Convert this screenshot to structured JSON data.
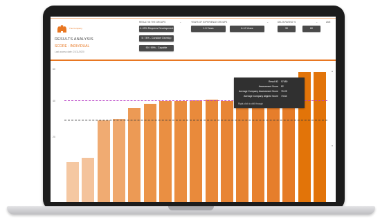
{
  "header": {
    "logo_text": "The Company",
    "title": "RESULTS ANALYSIS",
    "subtitle": "SCORE - INDIVIDUAL",
    "last_update": "Last access date: 21/11/2020"
  },
  "filters": {
    "result_group": {
      "label": "RESULT IN THE GROUPS",
      "options": [
        "4: 49% Requires Development",
        "5: 74% - Consider Develop",
        "90 / 99% - Capable"
      ]
    },
    "experience": {
      "label": "YEARS OF EXPERIENCE GROUPS",
      "options": [
        "1-5 Years",
        "6-10 Years"
      ]
    },
    "delta": {
      "label": "DELTA RATING %",
      "options": [
        "30",
        "60"
      ]
    },
    "extra_label": "ANE"
  },
  "chart_data": {
    "type": "bar",
    "y_ticks": [
      "60",
      "40",
      "20"
    ],
    "values": [
      30,
      33,
      61,
      62,
      70,
      73,
      75,
      75.5,
      76,
      76.5,
      75.5,
      74,
      76.5,
      76.5,
      77,
      97,
      97
    ],
    "reference_lines": [
      "individual average",
      "company average"
    ],
    "colors": [
      "#f5c8a2",
      "#f4c39c",
      "#f0ab72",
      "#efa86d",
      "#ec9a55",
      "#eb9448",
      "#ea8f42",
      "#ea8d3f",
      "#e98a3b",
      "#e98838",
      "#e88535",
      "#e78331",
      "#e7812e",
      "#e67e2b",
      "#e57b27",
      "#e27409",
      "#e27409"
    ]
  },
  "tooltip": {
    "rows": [
      {
        "key": "Result ID",
        "value": "97480"
      },
      {
        "key": "Assessment Score",
        "value": "82"
      },
      {
        "key": "Average Company Assessment Score",
        "value": "76.28"
      },
      {
        "key": "Average Company Aligned Score",
        "value": "73.84"
      }
    ],
    "drill": "Right-click to drill through"
  }
}
